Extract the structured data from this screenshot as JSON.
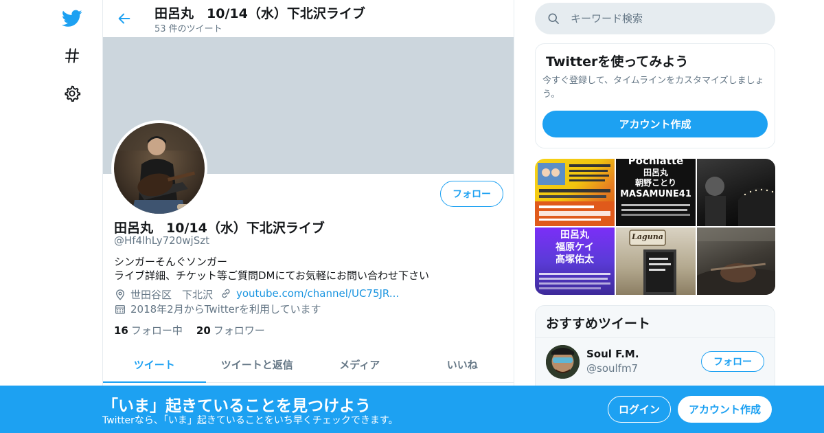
{
  "nav": {
    "icons": [
      "twitter-bird-icon",
      "hashtag-icon",
      "settings-gear-icon"
    ]
  },
  "header": {
    "title": "田呂丸　10/14（水）下北沢ライブ",
    "tweet_count": "53 件のツイート"
  },
  "profile": {
    "name": "田呂丸　10/14（水）下北沢ライブ",
    "handle": "@Hf4lhLy720wjSzt",
    "bio_line1": "シンガーそんぐソンガー",
    "bio_line2": "ライブ詳細、チケット等ご質問DMにてお気軽にお問い合わせ下さい",
    "location": "世田谷区　下北沢",
    "url": "youtube.com/channel/UC75JR...",
    "joined": "2018年2月からTwitterを利用しています",
    "following_count": "16",
    "following_label": "フォロー中",
    "followers_count": "20",
    "followers_label": "フォロワー",
    "follow_button": "フォロー"
  },
  "tabs": [
    "ツイート",
    "ツイートと返信",
    "メディア",
    "いいね"
  ],
  "active_tab": 0,
  "search": {
    "placeholder": "キーワード検索"
  },
  "try_card": {
    "title": "Twitterを使ってみよう",
    "text": "今すぐ登録して、タイムラインをカスタマイズしましょう。",
    "button": "アカウント作成"
  },
  "media": {
    "poster2_line1": "Pochiatte",
    "poster2_line2": "田呂丸",
    "poster2_line3": "朝野ことり",
    "poster2_line4": "MASAMUNE41",
    "poster4_line1": "田呂丸",
    "poster4_line2": "福原ケイ",
    "poster4_line3": "髙塚佑太",
    "poster5_sign": "Laguna"
  },
  "recommend": {
    "title": "おすすめツイート",
    "name": "Soul F.M.",
    "handle": "@soulfm7",
    "follow_button": "フォロー"
  },
  "bottom_bar": {
    "title": "「いま」起きていることを見つけよう",
    "subtitle": "Twitterなら、「いま」起きていることをいち早くチェックできます。",
    "login": "ログイン",
    "signup": "アカウント作成"
  },
  "colors": {
    "accent": "#1da1f2",
    "banner": "#ccd6dd",
    "muted_text": "#657786"
  }
}
